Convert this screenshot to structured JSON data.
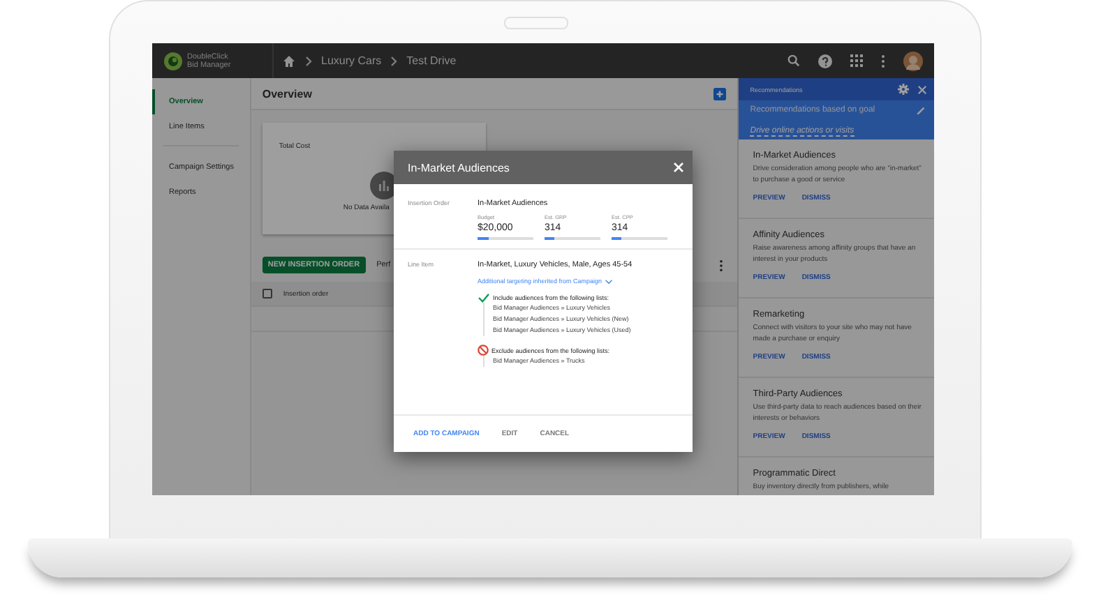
{
  "app": {
    "logo_lines": [
      "DoubleClick",
      "Bid Manager"
    ],
    "breadcrumbs": [
      "Luxury Cars",
      "Test Drive"
    ]
  },
  "sidebar": {
    "items": [
      {
        "label": "Overview",
        "selected": true
      },
      {
        "label": "Line Items",
        "selected": false
      },
      {
        "label": "Campaign Settings",
        "selected": false
      },
      {
        "label": "Reports",
        "selected": false
      }
    ]
  },
  "page": {
    "title": "Overview",
    "card": {
      "title": "Total Cost",
      "empty_text": "No Data Availa"
    },
    "new_button": "NEW INSERTION ORDER",
    "tab_partial": "Perf",
    "table": {
      "columns": [
        "Insertion order"
      ],
      "select_all_checked": false
    }
  },
  "recommendations": {
    "title": "Recommendations",
    "goal_label": "Recommendations based on goal",
    "goal": "Drive online actions or visits",
    "items": [
      {
        "title": "In-Market Audiences",
        "description": "Drive consideration among people who are “in-market” to purchase a good or service",
        "actions": [
          "PREVIEW",
          "DISMISS"
        ]
      },
      {
        "title": "Affinity Audiences",
        "description": "Raise awareness among affinity groups that have an interest in your products",
        "actions": [
          "PREVIEW",
          "DISMISS"
        ]
      },
      {
        "title": "Remarketing",
        "description": "Connect with visitors to your site who may not have made a purchase or enquiry",
        "actions": [
          "PREVIEW",
          "DISMISS"
        ]
      },
      {
        "title": "Third-Party Audiences",
        "description": "Use third-party data to reach audiences based on their interests or behaviors",
        "actions": [
          "PREVIEW",
          "DISMISS"
        ]
      },
      {
        "title": "Programmatic Direct",
        "description": "Buy inventory directly from publishers, while"
      }
    ]
  },
  "dialog": {
    "title": "In-Market Audiences",
    "insertion_order_label": "Insertion Order",
    "insertion_order": "In-Market Audiences",
    "metrics": [
      {
        "label": "Budget",
        "value": "$20,000",
        "level": 0.2
      },
      {
        "label": "Est. GRP",
        "value": "314",
        "level": 0.18
      },
      {
        "label": "Est. CPP",
        "value": "314",
        "level": 0.18
      }
    ],
    "line_item_label": "Line Item",
    "line_item": "In-Market, Luxury Vehicles, Male, Ages 45-54",
    "targeting_link": "Additional targeting inherited from Campaign",
    "rules": [
      {
        "kind": "include",
        "heading": "Include audiences from the following lists:",
        "items": [
          "Bid Manager Audiences » Luxury Vehicles",
          "Bid Manager Audiences » Luxury Vehicles (New)",
          "Bid Manager Audiences » Luxury Vehicles (Used)"
        ]
      },
      {
        "kind": "exclude",
        "heading": "Exclude audiences from the following lists:",
        "items": [
          "Bid Manager Audiences » Trucks"
        ]
      }
    ],
    "buttons": [
      {
        "label": "ADD TO CAMPAIGN",
        "kind": "primary"
      },
      {
        "label": "EDIT",
        "kind": "plain"
      },
      {
        "label": "CANCEL",
        "kind": "plain"
      }
    ]
  }
}
